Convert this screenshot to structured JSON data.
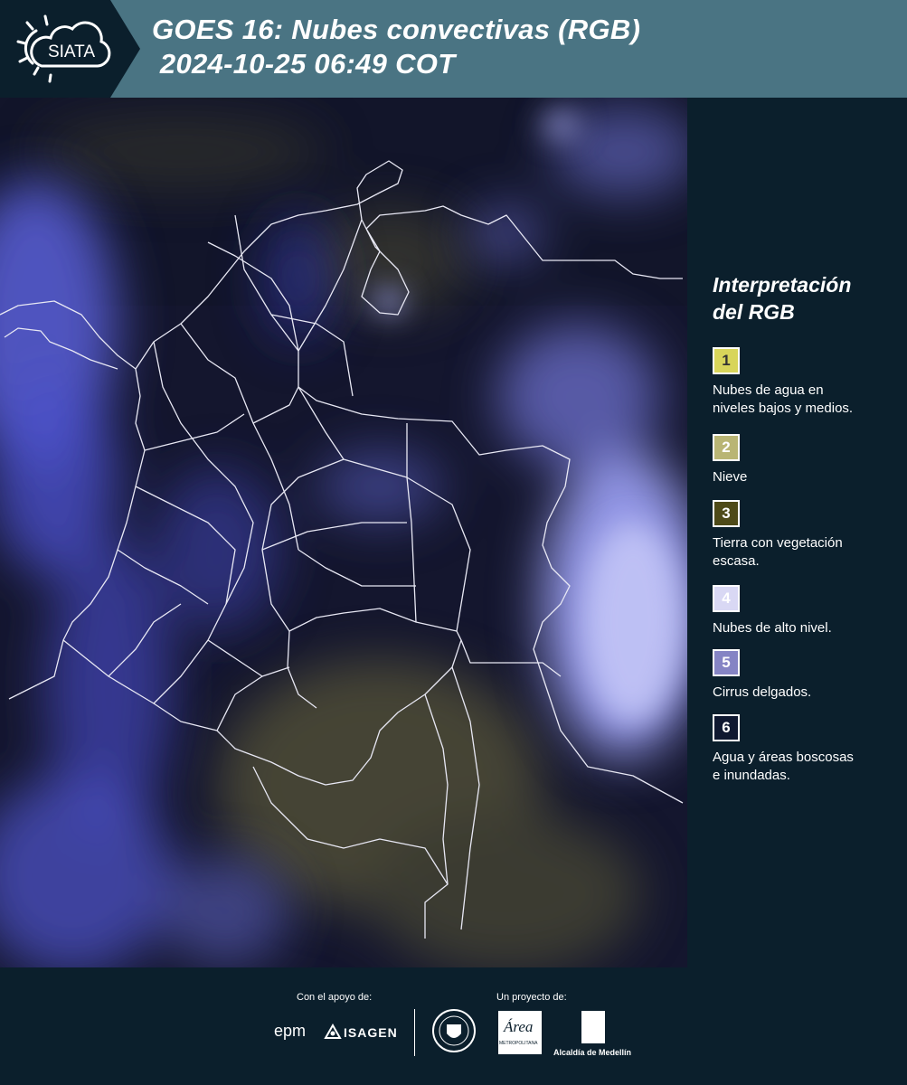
{
  "header": {
    "logo_text": "SIATA",
    "title_line1": "GOES 16: Nubes convectivas (RGB)",
    "title_line2": " 2024-10-25 06:49 COT"
  },
  "legend": {
    "title_line1": "Interpretación",
    "title_line2": "del RGB",
    "items": [
      {
        "number": "1",
        "color": "#d8d55a",
        "text_color": "#333333",
        "label_line1": "Nubes de agua en",
        "label_line2": "niveles bajos y medios."
      },
      {
        "number": "2",
        "color": "#b9b574",
        "text_color": "#ffffff",
        "label_line1": "Nieve",
        "label_line2": ""
      },
      {
        "number": "3",
        "color": "#4e4a18",
        "text_color": "#ffffff",
        "label_line1": "Tierra con vegetación",
        "label_line2": "escasa."
      },
      {
        "number": "4",
        "color": "#d9d8f4",
        "text_color": "#ffffff",
        "label_line1": "Nubes de alto nivel.",
        "label_line2": ""
      },
      {
        "number": "5",
        "color": "#8584c4",
        "text_color": "#ffffff",
        "label_line1": "Cirrus delgados.",
        "label_line2": ""
      },
      {
        "number": "6",
        "color": "#0f1830",
        "text_color": "#ffffff",
        "label_line1": "Agua y áreas boscosas",
        "label_line2": "e inundadas."
      }
    ]
  },
  "footer": {
    "support_label": "Con el apoyo de:",
    "project_label": "Un proyecto de:",
    "epm_logo": "epm",
    "isagen_logo": "ISAGEN",
    "area_logo": "Área",
    "area_sub": "METROPOLITANA",
    "alcaldia_label": "Alcaldía de Medellín"
  }
}
